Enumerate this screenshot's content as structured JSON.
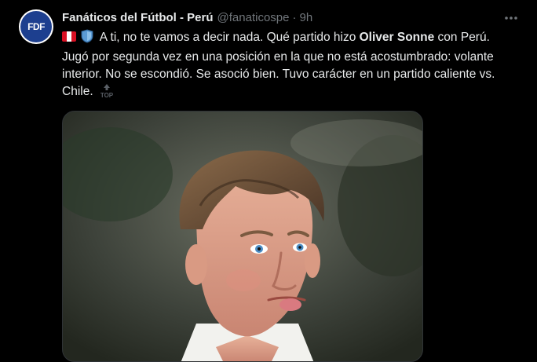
{
  "account": {
    "avatar_text": "FDF",
    "display_name": "Fanáticos del Fútbol - Perú",
    "handle": "@fanaticospe",
    "separator": "·",
    "time": "9h"
  },
  "tweet": {
    "text_1": " A ti, no te vamos a decir nada. Qué partido hizo ",
    "bold_name": "Oliver Sonne",
    "text_2": " con Perú. Jugó por segunda vez en una posición en la que no está acostumbrado: volante interior. No se escondió. Se asoció bien. Tuvo carácter en un partido caliente vs. Chile. ",
    "emoji_peru_flag": "peru-flag-icon",
    "emoji_shield": "blue-shield-icon",
    "emoji_top": "top-arrow-icon"
  },
  "icons": {
    "more": "more-options-icon"
  },
  "colors": {
    "background": "#000000",
    "text": "#e7e9ea",
    "muted": "#71767b",
    "avatar_blue": "#1d3f8f",
    "flag_red": "#d91023"
  }
}
